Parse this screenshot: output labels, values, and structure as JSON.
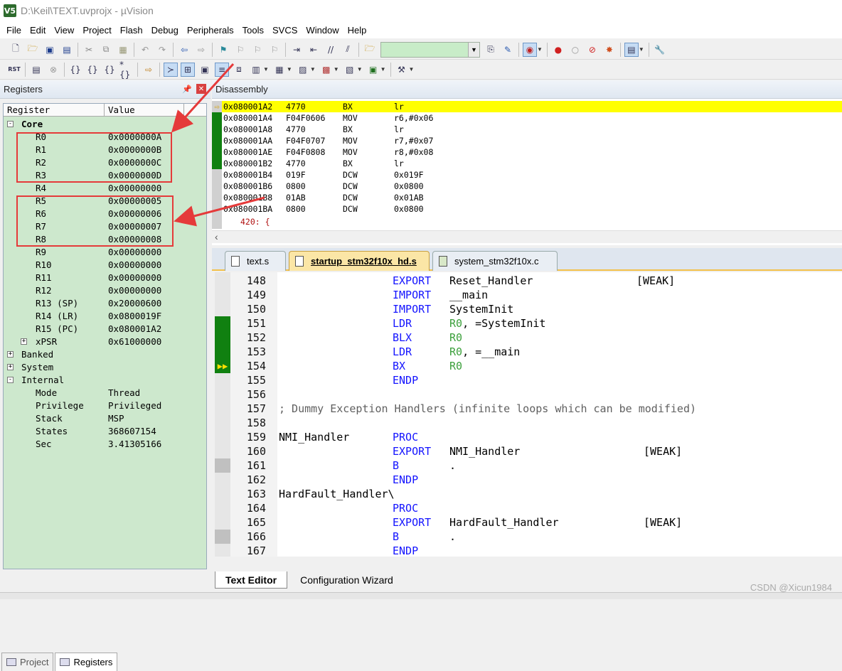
{
  "window": {
    "title": "D:\\Keil\\TEXT.uvprojx - µVision",
    "icon_text": "V5"
  },
  "menu": [
    "File",
    "Edit",
    "View",
    "Project",
    "Flash",
    "Debug",
    "Peripherals",
    "Tools",
    "SVCS",
    "Window",
    "Help"
  ],
  "registers_panel": {
    "title": "Registers",
    "col_register": "Register",
    "col_value": "Value",
    "rows": [
      {
        "name": "Core",
        "value": "",
        "level": 0,
        "toggle": "-",
        "bold": true
      },
      {
        "name": "R0",
        "value": "0x0000000A",
        "level": 1
      },
      {
        "name": "R1",
        "value": "0x0000000B",
        "level": 1
      },
      {
        "name": "R2",
        "value": "0x0000000C",
        "level": 1
      },
      {
        "name": "R3",
        "value": "0x0000000D",
        "level": 1
      },
      {
        "name": "R4",
        "value": "0x00000000",
        "level": 1
      },
      {
        "name": "R5",
        "value": "0x00000005",
        "level": 1
      },
      {
        "name": "R6",
        "value": "0x00000006",
        "level": 1
      },
      {
        "name": "R7",
        "value": "0x00000007",
        "level": 1
      },
      {
        "name": "R8",
        "value": "0x00000008",
        "level": 1
      },
      {
        "name": "R9",
        "value": "0x00000000",
        "level": 1
      },
      {
        "name": "R10",
        "value": "0x00000000",
        "level": 1
      },
      {
        "name": "R11",
        "value": "0x00000000",
        "level": 1
      },
      {
        "name": "R12",
        "value": "0x00000000",
        "level": 1
      },
      {
        "name": "R13 (SP)",
        "value": "0x20000600",
        "level": 1
      },
      {
        "name": "R14 (LR)",
        "value": "0x0800019F",
        "level": 1
      },
      {
        "name": "R15 (PC)",
        "value": "0x080001A2",
        "level": 1
      },
      {
        "name": "xPSR",
        "value": "0x61000000",
        "level": 1,
        "toggle": "+"
      },
      {
        "name": "Banked",
        "value": "",
        "level": 0,
        "toggle": "+"
      },
      {
        "name": "System",
        "value": "",
        "level": 0,
        "toggle": "+"
      },
      {
        "name": "Internal",
        "value": "",
        "level": 0,
        "toggle": "-"
      },
      {
        "name": "Mode",
        "value": "Thread",
        "level": 1
      },
      {
        "name": "Privilege",
        "value": "Privileged",
        "level": 1
      },
      {
        "name": "Stack",
        "value": "MSP",
        "level": 1
      },
      {
        "name": "States",
        "value": "368607154",
        "level": 1
      },
      {
        "name": "Sec",
        "value": "3.41305166",
        "level": 1
      }
    ],
    "tabs": [
      "Project",
      "Registers"
    ],
    "active_tab": "Registers"
  },
  "disassembly": {
    "title": "Disassembly",
    "lines": [
      {
        "addr": "0x080001A2",
        "op": "4770",
        "mn": "BX",
        "arg": "lr",
        "current": true
      },
      {
        "addr": "0x080001A4",
        "op": "F04F0606",
        "mn": "MOV",
        "arg": "r6,#0x06"
      },
      {
        "addr": "0x080001A8",
        "op": "4770",
        "mn": "BX",
        "arg": "lr"
      },
      {
        "addr": "0x080001AA",
        "op": "F04F0707",
        "mn": "MOV",
        "arg": "r7,#0x07"
      },
      {
        "addr": "0x080001AE",
        "op": "F04F0808",
        "mn": "MOV",
        "arg": "r8,#0x08"
      },
      {
        "addr": "0x080001B2",
        "op": "4770",
        "mn": "BX",
        "arg": "lr"
      },
      {
        "addr": "0x080001B4",
        "op": "019F",
        "mn": "DCW",
        "arg": "0x019F"
      },
      {
        "addr": "0x080001B6",
        "op": "0800",
        "mn": "DCW",
        "arg": "0x0800"
      },
      {
        "addr": "0x080001B8",
        "op": "01AB",
        "mn": "DCW",
        "arg": "0x01AB"
      },
      {
        "addr": "0x080001BA",
        "op": "0800",
        "mn": "DCW",
        "arg": "0x0800"
      }
    ],
    "source_line": "420: {"
  },
  "file_tabs": [
    {
      "label": "text.s",
      "active": false
    },
    {
      "label": "startup_stm32f10x_hd.s",
      "active": true
    },
    {
      "label": "system_stm32f10x.c",
      "active": false
    }
  ],
  "editor": {
    "lines": [
      {
        "n": "148",
        "label": "",
        "kw": "EXPORT",
        "rest": "Reset_Handler",
        "restClass": "",
        "tail": "[WEAK]"
      },
      {
        "n": "149",
        "label": "",
        "kw": "IMPORT",
        "rest": "__main",
        "restClass": "",
        "tail": ""
      },
      {
        "n": "150",
        "label": "",
        "kw": "IMPORT",
        "rest": "SystemInit",
        "restClass": "",
        "tail": ""
      },
      {
        "n": "151",
        "label": "",
        "kw": "LDR",
        "rest": "R0",
        "restClass": "reg",
        "tail": ", =SystemInit"
      },
      {
        "n": "152",
        "label": "",
        "kw": "BLX",
        "rest": "R0",
        "restClass": "reg",
        "tail": ""
      },
      {
        "n": "153",
        "label": "",
        "kw": "LDR",
        "rest": "R0",
        "restClass": "reg",
        "tail": ", =__main"
      },
      {
        "n": "154",
        "label": "",
        "kw": "BX",
        "rest": "R0",
        "restClass": "reg",
        "tail": ""
      },
      {
        "n": "155",
        "label": "",
        "kw": "ENDP",
        "rest": "",
        "restClass": "",
        "tail": ""
      },
      {
        "n": "156",
        "label": "",
        "kw": "",
        "rest": "",
        "restClass": "",
        "tail": ""
      },
      {
        "n": "157",
        "comment": "; Dummy Exception Handlers (infinite loops which can be modified)"
      },
      {
        "n": "158",
        "label": "",
        "kw": "",
        "rest": "",
        "restClass": "",
        "tail": ""
      },
      {
        "n": "159",
        "label": "NMI_Handler",
        "kw": "PROC",
        "rest": "",
        "restClass": "",
        "tail": ""
      },
      {
        "n": "160",
        "label": "",
        "kw": "EXPORT",
        "rest": "NMI_Handler",
        "restClass": "",
        "tail": "[WEAK]"
      },
      {
        "n": "161",
        "label": "",
        "kw": "B",
        "rest": ".",
        "restClass": "",
        "tail": ""
      },
      {
        "n": "162",
        "label": "",
        "kw": "ENDP",
        "rest": "",
        "restClass": "",
        "tail": ""
      },
      {
        "n": "163",
        "label": "HardFault_Handler\\",
        "kw": "",
        "rest": "",
        "restClass": "",
        "tail": ""
      },
      {
        "n": "164",
        "label": "",
        "kw": "PROC",
        "rest": "",
        "restClass": "",
        "tail": ""
      },
      {
        "n": "165",
        "label": "",
        "kw": "EXPORT",
        "rest": "HardFault_Handler",
        "restClass": "",
        "tail": "[WEAK]"
      },
      {
        "n": "166",
        "label": "",
        "kw": "B",
        "rest": ".",
        "restClass": "",
        "tail": ""
      },
      {
        "n": "167",
        "label": "",
        "kw": "ENDP",
        "rest": "",
        "restClass": "",
        "tail": ""
      }
    ]
  },
  "editor_tabs": [
    {
      "label": "Text Editor",
      "active": true
    },
    {
      "label": "Configuration Wizard",
      "active": false
    }
  ],
  "watermark": "CSDN @Xicun1984",
  "colors": {
    "current_line": "#ffff00",
    "register_bg": "#cde8cd",
    "annotation": "#e53a3a",
    "keyword": "#1414ff",
    "register_operand": "#3ca03c"
  }
}
